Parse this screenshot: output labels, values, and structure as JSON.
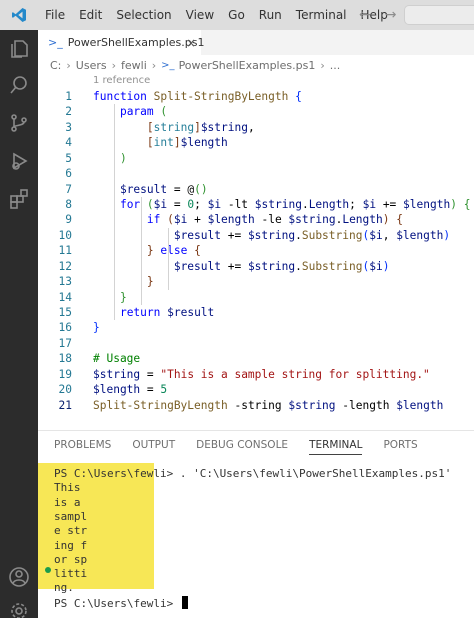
{
  "menu": [
    "File",
    "Edit",
    "Selection",
    "View",
    "Go",
    "Run",
    "Terminal",
    "Help"
  ],
  "icons": {
    "logo": "vscode-logo",
    "nav_back": "arrow-left",
    "nav_forward": "arrow-right",
    "activity": [
      "explorer-icon",
      "search-icon",
      "source-control-icon",
      "run-debug-icon",
      "extensions-icon"
    ],
    "bottom": [
      "account-icon",
      "settings-gear-icon"
    ]
  },
  "colors": {
    "accent": "#007acc",
    "highlight": "#f7e756",
    "activity_bar": "#2c2c2c"
  },
  "tab": {
    "label": "PowerShellExamples.ps1",
    "close": "×"
  },
  "breadcrumb": {
    "parts": [
      "C:",
      "Users",
      "fewli",
      "PowerShellExamples.ps1",
      "..."
    ]
  },
  "editor": {
    "codelens": "1 reference",
    "lines": [
      {
        "n": "1",
        "tokens": [
          [
            "kw",
            "function"
          ],
          [
            "pl",
            " "
          ],
          [
            "fn",
            "Split-StringByLength"
          ],
          [
            "pl",
            " "
          ],
          [
            "brk",
            "{"
          ]
        ]
      },
      {
        "n": "2",
        "tokens": [
          [
            "pl",
            "    "
          ],
          [
            "kw",
            "param"
          ],
          [
            "pl",
            " "
          ],
          [
            "brk2",
            "("
          ]
        ]
      },
      {
        "n": "3",
        "tokens": [
          [
            "pl",
            "        "
          ],
          [
            "brk3",
            "["
          ],
          [
            "type",
            "string"
          ],
          [
            "brk3",
            "]"
          ],
          [
            "var",
            "$string"
          ],
          [
            "pl",
            ","
          ]
        ]
      },
      {
        "n": "4",
        "tokens": [
          [
            "pl",
            "        "
          ],
          [
            "brk3",
            "["
          ],
          [
            "type",
            "int"
          ],
          [
            "brk3",
            "]"
          ],
          [
            "var",
            "$length"
          ]
        ]
      },
      {
        "n": "5",
        "tokens": [
          [
            "pl",
            "    "
          ],
          [
            "brk2",
            ")"
          ]
        ]
      },
      {
        "n": "6",
        "tokens": []
      },
      {
        "n": "7",
        "tokens": [
          [
            "pl",
            "    "
          ],
          [
            "var",
            "$result"
          ],
          [
            "op",
            " = "
          ],
          [
            "op",
            "@"
          ],
          [
            "brk2",
            "("
          ],
          [
            "brk2",
            ")"
          ]
        ]
      },
      {
        "n": "8",
        "tokens": [
          [
            "pl",
            "    "
          ],
          [
            "kw",
            "for"
          ],
          [
            "pl",
            " "
          ],
          [
            "brk2",
            "("
          ],
          [
            "var",
            "$i"
          ],
          [
            "op",
            " = "
          ],
          [
            "num",
            "0"
          ],
          [
            "pl",
            "; "
          ],
          [
            "var",
            "$i"
          ],
          [
            "op",
            " -lt "
          ],
          [
            "var",
            "$string"
          ],
          [
            "pl",
            "."
          ],
          [
            "var",
            "Length"
          ],
          [
            "pl",
            "; "
          ],
          [
            "var",
            "$i"
          ],
          [
            "op",
            " += "
          ],
          [
            "var",
            "$length"
          ],
          [
            "brk2",
            ")"
          ],
          [
            "pl",
            " "
          ],
          [
            "brk2",
            "{"
          ]
        ]
      },
      {
        "n": "9",
        "tokens": [
          [
            "pl",
            "        "
          ],
          [
            "kw",
            "if"
          ],
          [
            "pl",
            " "
          ],
          [
            "brk3",
            "("
          ],
          [
            "var",
            "$i"
          ],
          [
            "op",
            " + "
          ],
          [
            "var",
            "$length"
          ],
          [
            "op",
            " -le "
          ],
          [
            "var",
            "$string"
          ],
          [
            "pl",
            "."
          ],
          [
            "var",
            "Length"
          ],
          [
            "brk3",
            ")"
          ],
          [
            "pl",
            " "
          ],
          [
            "brk3",
            "{"
          ]
        ]
      },
      {
        "n": "10",
        "tokens": [
          [
            "pl",
            "            "
          ],
          [
            "var",
            "$result"
          ],
          [
            "op",
            " += "
          ],
          [
            "var",
            "$string"
          ],
          [
            "pl",
            "."
          ],
          [
            "fn",
            "Substring"
          ],
          [
            "brk",
            "("
          ],
          [
            "var",
            "$i"
          ],
          [
            "pl",
            ", "
          ],
          [
            "var",
            "$length"
          ],
          [
            "brk",
            ")"
          ]
        ]
      },
      {
        "n": "11",
        "tokens": [
          [
            "pl",
            "        "
          ],
          [
            "brk3",
            "}"
          ],
          [
            "pl",
            " "
          ],
          [
            "kw",
            "else"
          ],
          [
            "pl",
            " "
          ],
          [
            "brk3",
            "{"
          ]
        ]
      },
      {
        "n": "12",
        "tokens": [
          [
            "pl",
            "            "
          ],
          [
            "var",
            "$result"
          ],
          [
            "op",
            " += "
          ],
          [
            "var",
            "$string"
          ],
          [
            "pl",
            "."
          ],
          [
            "fn",
            "Substring"
          ],
          [
            "brk",
            "("
          ],
          [
            "var",
            "$i"
          ],
          [
            "brk",
            ")"
          ]
        ]
      },
      {
        "n": "13",
        "tokens": [
          [
            "pl",
            "        "
          ],
          [
            "brk3",
            "}"
          ]
        ]
      },
      {
        "n": "14",
        "tokens": [
          [
            "pl",
            "    "
          ],
          [
            "brk2",
            "}"
          ]
        ]
      },
      {
        "n": "15",
        "tokens": [
          [
            "pl",
            "    "
          ],
          [
            "kw",
            "return"
          ],
          [
            "pl",
            " "
          ],
          [
            "var",
            "$result"
          ]
        ]
      },
      {
        "n": "16",
        "tokens": [
          [
            "brk",
            "}"
          ]
        ]
      },
      {
        "n": "17",
        "tokens": []
      },
      {
        "n": "18",
        "tokens": [
          [
            "cm",
            "# Usage"
          ]
        ]
      },
      {
        "n": "19",
        "tokens": [
          [
            "var",
            "$string"
          ],
          [
            "op",
            " = "
          ],
          [
            "str",
            "\"This is a sample string for splitting.\""
          ]
        ]
      },
      {
        "n": "20",
        "tokens": [
          [
            "var",
            "$length"
          ],
          [
            "op",
            " = "
          ],
          [
            "num",
            "5"
          ]
        ]
      },
      {
        "n": "21",
        "tokens": [
          [
            "fn",
            "Split-StringByLength"
          ],
          [
            "pl",
            " "
          ],
          [
            "op",
            "-string"
          ],
          [
            "pl",
            " "
          ],
          [
            "var",
            "$string"
          ],
          [
            "pl",
            " "
          ],
          [
            "op",
            "-length"
          ],
          [
            "pl",
            " "
          ],
          [
            "var",
            "$length"
          ]
        ]
      }
    ]
  },
  "panel": {
    "tabs": [
      "PROBLEMS",
      "OUTPUT",
      "DEBUG CONSOLE",
      "TERMINAL",
      "PORTS"
    ],
    "active_tab": "TERMINAL"
  },
  "terminal": {
    "command_line": "PS C:\\Users\\fewli> . 'C:\\Users\\fewli\\PowerShellExamples.ps1'",
    "output": [
      "This",
      "is a",
      "sampl",
      "e str",
      "ing f",
      "or sp",
      "litti",
      "ng."
    ],
    "prompt": "PS C:\\Users\\fewli> "
  }
}
